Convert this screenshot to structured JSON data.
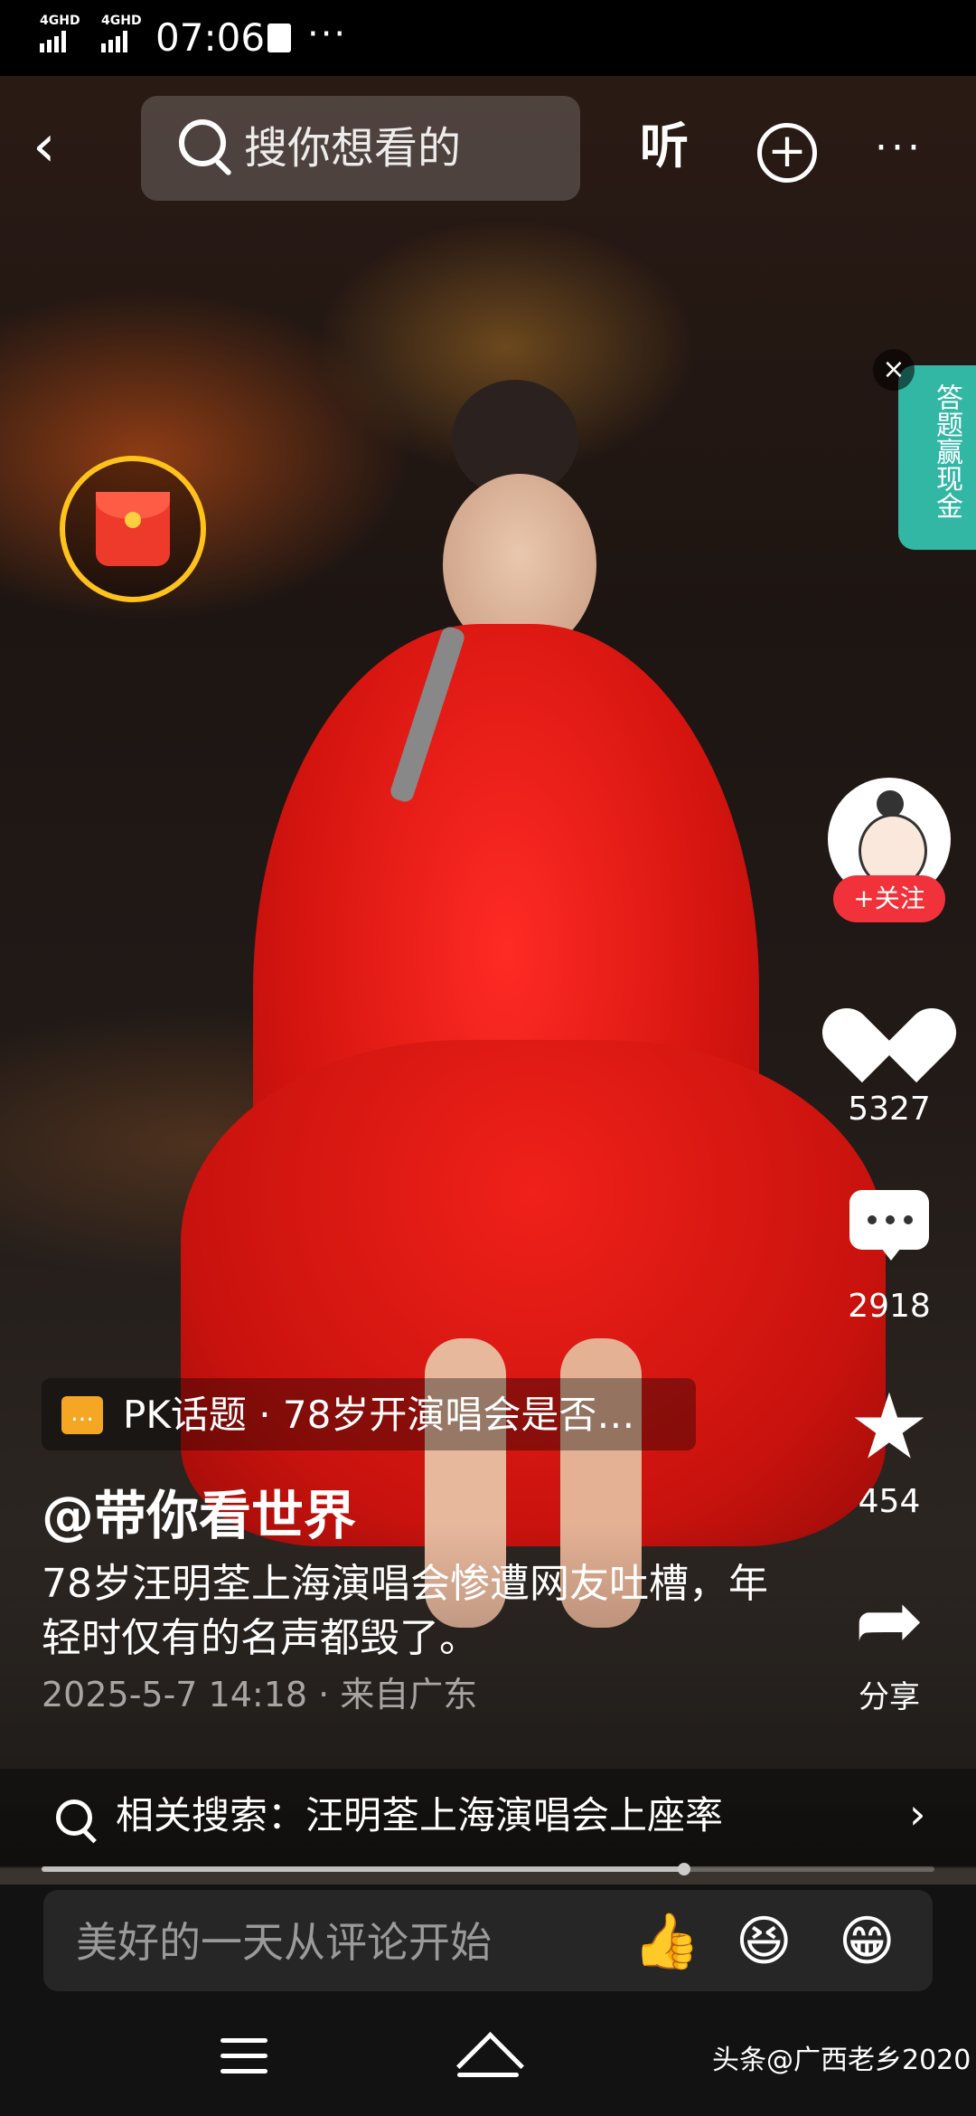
{
  "status_bar": {
    "network_1": "4GHD",
    "network_2": "4GHD",
    "time": "07:06",
    "more": "···"
  },
  "top_bar": {
    "search_placeholder": "搜你想看的",
    "listen_label": "听",
    "add_icon": "plus-circle-icon",
    "more_icon": "more-horizontal-icon"
  },
  "red_packet": {
    "icon": "red-envelope-icon",
    "accent": "#ffc21a"
  },
  "quiz_badge": {
    "label": "答题赢现金",
    "color": "#33b7a5"
  },
  "actions": {
    "follow_label": "+关注",
    "like_count": "5327",
    "comment_count": "2918",
    "favorite_count": "454",
    "share_label": "分享"
  },
  "post": {
    "pk_topic": "PK话题 · 78岁开演唱会是否…",
    "author": "@带你看世界",
    "caption": "78岁汪明荃上海演唱会惨遭网友吐槽，年轻时仅有的名声都毁了。",
    "meta": "2025-5-7 14:18 · 来自广东"
  },
  "related_search": {
    "text": "相关搜索：汪明荃上海演唱会上座率",
    "arrow": "›"
  },
  "playback": {
    "progress": 0.72
  },
  "comment_bar": {
    "placeholder": "美好的一天从评论开始",
    "emoji_1": "👍",
    "emoji_2": "😆",
    "emoji_3": "😁"
  },
  "nav_bar": {
    "watermark": "头条@广西老乡2020"
  },
  "colors": {
    "follow_red": "#f2323a",
    "pk_orange": "#f5a623"
  }
}
